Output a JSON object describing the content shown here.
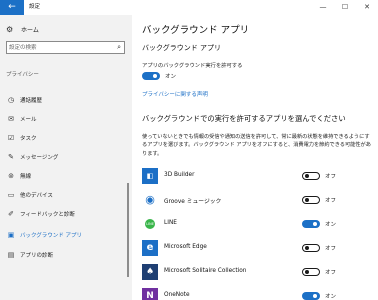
{
  "window": {
    "back_glyph": "←",
    "title": "設定",
    "minimize": "—",
    "maximize": "☐",
    "close": "✕"
  },
  "sidebar": {
    "home_icon": "gear-icon",
    "home_label": "ホーム",
    "search_placeholder": "設定の検索",
    "section_label": "プライバシー",
    "items": [
      {
        "label": "通話履歴",
        "icon": "call-history-icon",
        "glyph": "◷"
      },
      {
        "label": "メール",
        "icon": "mail-icon",
        "glyph": "✉"
      },
      {
        "label": "タスク",
        "icon": "tasks-icon",
        "glyph": "☑"
      },
      {
        "label": "メッセージング",
        "icon": "messaging-icon",
        "glyph": "✎"
      },
      {
        "label": "無線",
        "icon": "radios-icon",
        "glyph": "⊚"
      },
      {
        "label": "他のデバイス",
        "icon": "devices-icon",
        "glyph": "▭"
      },
      {
        "label": "フィードバックと診断",
        "icon": "feedback-icon",
        "glyph": "✐"
      },
      {
        "label": "バックグラウンド アプリ",
        "icon": "background-apps-icon",
        "glyph": "▣",
        "active": true
      },
      {
        "label": "アプリの診断",
        "icon": "app-diagnostics-icon",
        "glyph": "▤"
      }
    ]
  },
  "main": {
    "page_title": "バックグラウンド アプリ",
    "section1_heading": "バックグラウンド アプリ",
    "allow_label": "アプリのバックグラウンド実行を許可する",
    "allow_toggle_state": "オン",
    "privacy_link": "プライバシーに関する声明",
    "section2_heading": "バックグラウンドでの実行を許可するアプリを選んでください",
    "description": "使っていないときでも情報の受信や通知の送信を許可して、常に最新の状態を維持できるようにするアプリを選びます。バックグラウンド アプリをオフにすると、消費電力を節約できる可能性があります。",
    "apps": [
      {
        "name": "3D Builder",
        "state": "オフ",
        "on": false,
        "icon": "3d-builder-icon",
        "color": "#1c6fc6",
        "glyph": "◧"
      },
      {
        "name": "Groove ミュージック",
        "state": "オフ",
        "on": false,
        "icon": "groove-music-icon",
        "color": "#ffffff",
        "glyph": "◉"
      },
      {
        "name": "LINE",
        "state": "オン",
        "on": true,
        "icon": "line-app-icon",
        "color": "#ffffff",
        "glyph": "LINE"
      },
      {
        "name": "Microsoft Edge",
        "state": "オフ",
        "on": false,
        "icon": "edge-icon",
        "color": "#1c6fc6",
        "glyph": "e"
      },
      {
        "name": "Microsoft Solitaire Collection",
        "state": "オフ",
        "on": false,
        "icon": "solitaire-icon",
        "color": "#1f3f73",
        "glyph": "♠"
      },
      {
        "name": "OneNote",
        "state": "オン",
        "on": true,
        "icon": "onenote-icon",
        "color": "#7030a0",
        "glyph": "N"
      }
    ]
  }
}
